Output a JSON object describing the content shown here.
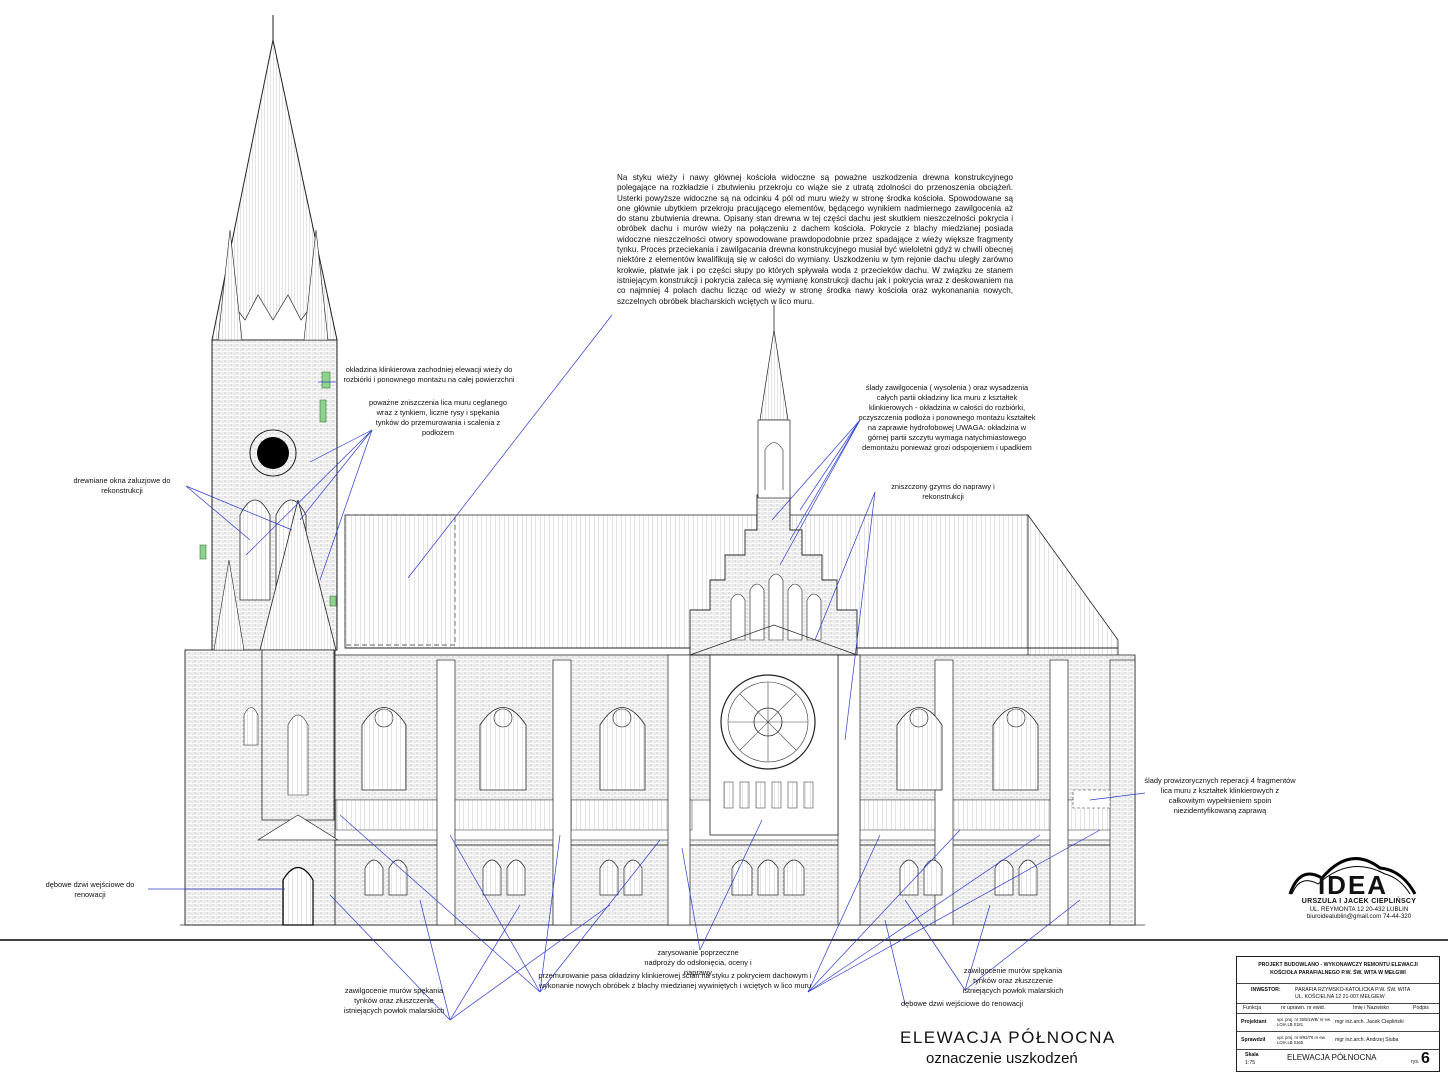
{
  "drawing": {
    "main_note": "Na styku wieży i nawy głównej kościoła widoczne są poważne uszkodzenia drewna konstrukcyjnego polegające na rozkładzie i zbutwieniu przekroju co wiąże sie z utratą zdolności do przenoszenia obciążeń. Usterki powyższe widoczne są na odcinku 4 pól od muru wieży w stronę środka kościoła. Spowodowane są one głównie ubytkiem przekroju pracującego elementów, będącego wynikiem nadmiernego zawilgocenia aż do stanu zbutwienia drewna. Opisany stan drewna w tej części dachu jest skutkiem nieszczelności pokrycia i obróbek dachu i murów wieży na połączeniu z dachem kościoła. Pokrycie z blachy miedzianej posiada widoczne nieszczelności otwory spowodowane prawdopodobnie przez spadające z wieży większe fragmenty tynku. Proces przeciekania i zawilgacania drewna konstrukcyjnego musiał być wieloletni gdyż w chwili obecnej niektóre z elementów kwalifikują się w całości do wymiany. Uszkodzeniu w tym rejonie dachu uległy zarówno krokwie, płatwie jak i po części słupy po których spływała woda z przecieków dachu. W związku ze stanem istniejącym konstrukcji i pokrycia zaleca się wymianę konstrukcji dachu jak i pokrycia wraz z deskowaniem na co najmniej 4 polach dachu licząc od wieży w stronę środka nawy kościoła oraz wykonanania nowych, szczelnych obróbek blacharskich wciętych w lico muru.",
    "note_tower_cladding": "okładzina klinkierowa zachodniej elewacji wieży do rozbiórki i ponownego montażu na całej powierzchni",
    "note_brick_damage": "poważne zniszczenia lica muru ceglanego wraz z tynkiem, liczne rysy i spękania tynków do przemurowania i scalenia z podłożem",
    "note_windows": "drewniane okna żaluzjowe do rekonstrukcji",
    "note_gable": "ślady zawilgocenia ( wysolenia ) oraz wysadzenia całych partii okładziny lica muru z kształtek klinkierowych - okładzina w całości do rozbiórki, oczyszczenia podłoża i ponownego montażu kształtek na zaprawie hydrofobowej UWAGA: okładzina w górnej partii szczytu wymaga natychmiastowego demontażu ponieważ grozi odspojeniem i upadkiem",
    "note_cornice": "zniszczony gzyms do naprawy i rekonstrukcji",
    "note_repairs": "ślady prowizorycznych reperacji 4 fragmentów lica muru z kształtek klinkierowych z całkowitym wypełnieniem spoin niezidentyfikowaną zaprawą",
    "note_door_left": "dębowe dzwi wejściowe do renowacji",
    "note_lintel": "zarysowanie poprzeczne nadproży do odsłonięcia, oceny i naprawy",
    "note_band": "przemurowanie pasa okładziny klinkierowej ścian na styku z pokryciem dachowym i wykonanie nowych obróbek z blachy miedzianej wywiniętych i wciętych w lico muru",
    "note_moisture_left": "zawilgocenie murów spękania tynków oraz złuszczenie istniejących powłok malarskich",
    "note_moisture_right": "zawilgocenie murów spękania tynków oraz złuszczenie istniejących powłok malarskich",
    "note_door_right": "dębowe dzwi wejściowe do renowacji",
    "title": "ELEWACJA PÓŁNOCNA",
    "subtitle": "oznaczenie uszkodzeń"
  },
  "logo": {
    "brand": "IDEA",
    "name": "URSZULA I JACEK CIEPLIŃSCY",
    "address": "UL. REYMONTA 12 20-432 LUBLIN",
    "contact": "biuroidealublin@gmail.com 74-44-320"
  },
  "titleblock": {
    "project": "PROJEKT BUDOWLANO - WYKONAWCZY REMONTU ELEWACJI",
    "project2": "KOŚCIOŁA PARAFIALNEGO P.W. ŚW. WITA W MEŁGWI",
    "investor_label": "INWESTOR:",
    "investor": "PARAFIA RZYMSKO-KATOLICKA P.W. ŚW. WITA",
    "investor_addr": "UL. KOŚCIELNA 12 21-007 MEŁGIEW",
    "col_function": "Funkcja",
    "col_number": "nr uprawn. nr ewid.",
    "col_name": "Imię i Nazwisko",
    "col_sign": "Podpis",
    "designer_label": "Projektant",
    "designer_no": "upr. proj. nr 26/5/LWB/ nr ew. LOIA LB 0181",
    "designer_name": "mgr inż.arch. Jacek Ciepliński",
    "checker_label": "Sprawdził",
    "checker_no": "upr. proj. nr 9/93/76 nr ew. LOIA LB 0165",
    "checker_name": "mgr inż.arch. Andrzej Siuba",
    "scale_label": "Skala",
    "scale": "1:75",
    "sheet_title": "ELEWACJA PÓŁNOCNA",
    "sheet_label": "rys.",
    "sheet_no": "6"
  }
}
